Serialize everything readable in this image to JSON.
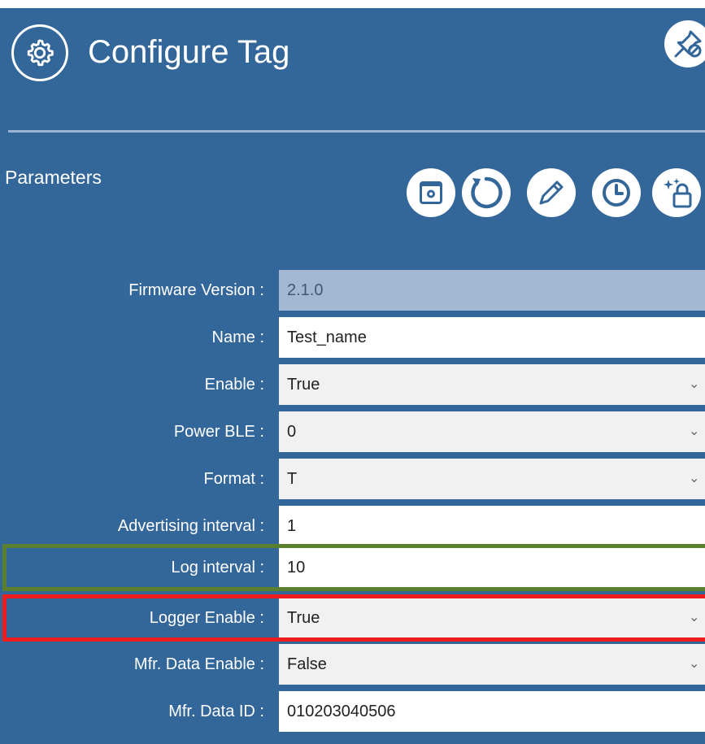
{
  "header": {
    "title": "Configure Tag",
    "icon": "gear-icon",
    "pin_icon": "pin-off-icon"
  },
  "section": {
    "label": "Parameters",
    "tools": [
      "window-settings-icon",
      "refresh-icon",
      "pencil-icon",
      "clock-icon",
      "sparkle-lock-icon"
    ]
  },
  "fields": [
    {
      "label": "Firmware Version :",
      "value": "2.1.0",
      "kind": "readonly"
    },
    {
      "label": "Name :",
      "value": "Test_name",
      "kind": "input"
    },
    {
      "label": "Enable :",
      "value": "True",
      "kind": "select"
    },
    {
      "label": "Power BLE :",
      "value": "0",
      "kind": "select"
    },
    {
      "label": "Format :",
      "value": "T",
      "kind": "select"
    },
    {
      "label": "Advertising interval :",
      "value": "1",
      "kind": "input"
    },
    {
      "label": "Log interval :",
      "value": "10",
      "kind": "input"
    },
    {
      "label": "Logger Enable :",
      "value": "True",
      "kind": "select"
    },
    {
      "label": "Mfr. Data Enable :",
      "value": "False",
      "kind": "select"
    },
    {
      "label": "Mfr. Data ID :",
      "value": "010203040506",
      "kind": "input"
    }
  ],
  "caret_glyph": "⌄",
  "colors": {
    "panel": "#336699",
    "highlight_green": "#5a7f2e",
    "highlight_red": "#ee1d1d"
  }
}
